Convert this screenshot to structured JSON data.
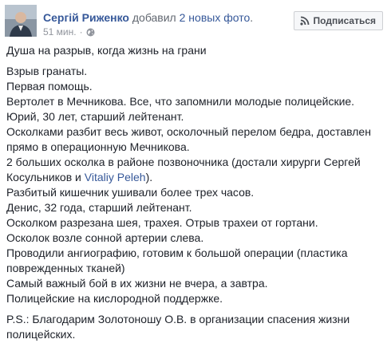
{
  "header": {
    "author_name": "Сергій Риженко",
    "action_prefix": " добавил ",
    "action_link": "2 новых фото",
    "action_suffix": ".",
    "timestamp": "51 мин.",
    "dot": "·",
    "privacy_icon": "globe-icon",
    "subscribe_label": "Подписаться",
    "subscribe_icon": "rss-icon"
  },
  "post": {
    "title": "Душа на разрыв, когда жизнь на грани",
    "lines": {
      "l1": "Взрыв гранаты.",
      "l2": "Первая помощь.",
      "l3": "Вертолет в Мечникова. Все, что запомнили молодые полицейские.",
      "l4": "Юрий, 30 лет, старший лейтенант.",
      "l5": "Осколками разбит весь живот, осколочный перелом бедра, доставлен",
      "l6": "прямо в операционную Мечникова.",
      "l7": "2 больших осколка в районе позвоночника (достали хирурги Сергей",
      "l8_prefix": "Косульников и ",
      "l8_mention": "Vitaliy Peleh",
      "l8_suffix": ").",
      "l9": "Разбитый кишечник ушивали более трех часов.",
      "l10": "Денис, 32 года, старший лейтенант.",
      "l11": "Осколком разрезана шея, трахея. Отрыв трахеи от гортани.",
      "l12": "Осколок возле сонной артерии слева.",
      "l13": "Проводили ангиографию, готовим к большой операции (пластика",
      "l14": "поврежденных тканей)",
      "l15": "Самый важный бой в их жизни не вчера, а завтра.",
      "l16": "Полицейские на кислородной поддержке."
    },
    "ps_line1": "P.S.: Благодарим Золотоношу О.В. в организации спасения жизни",
    "ps_line2": "полицейских."
  },
  "colors": {
    "link": "#365899",
    "text": "#1d2129",
    "meta": "#90949c",
    "button_bg": "#f6f7f9",
    "button_border": "#ced0d4"
  }
}
